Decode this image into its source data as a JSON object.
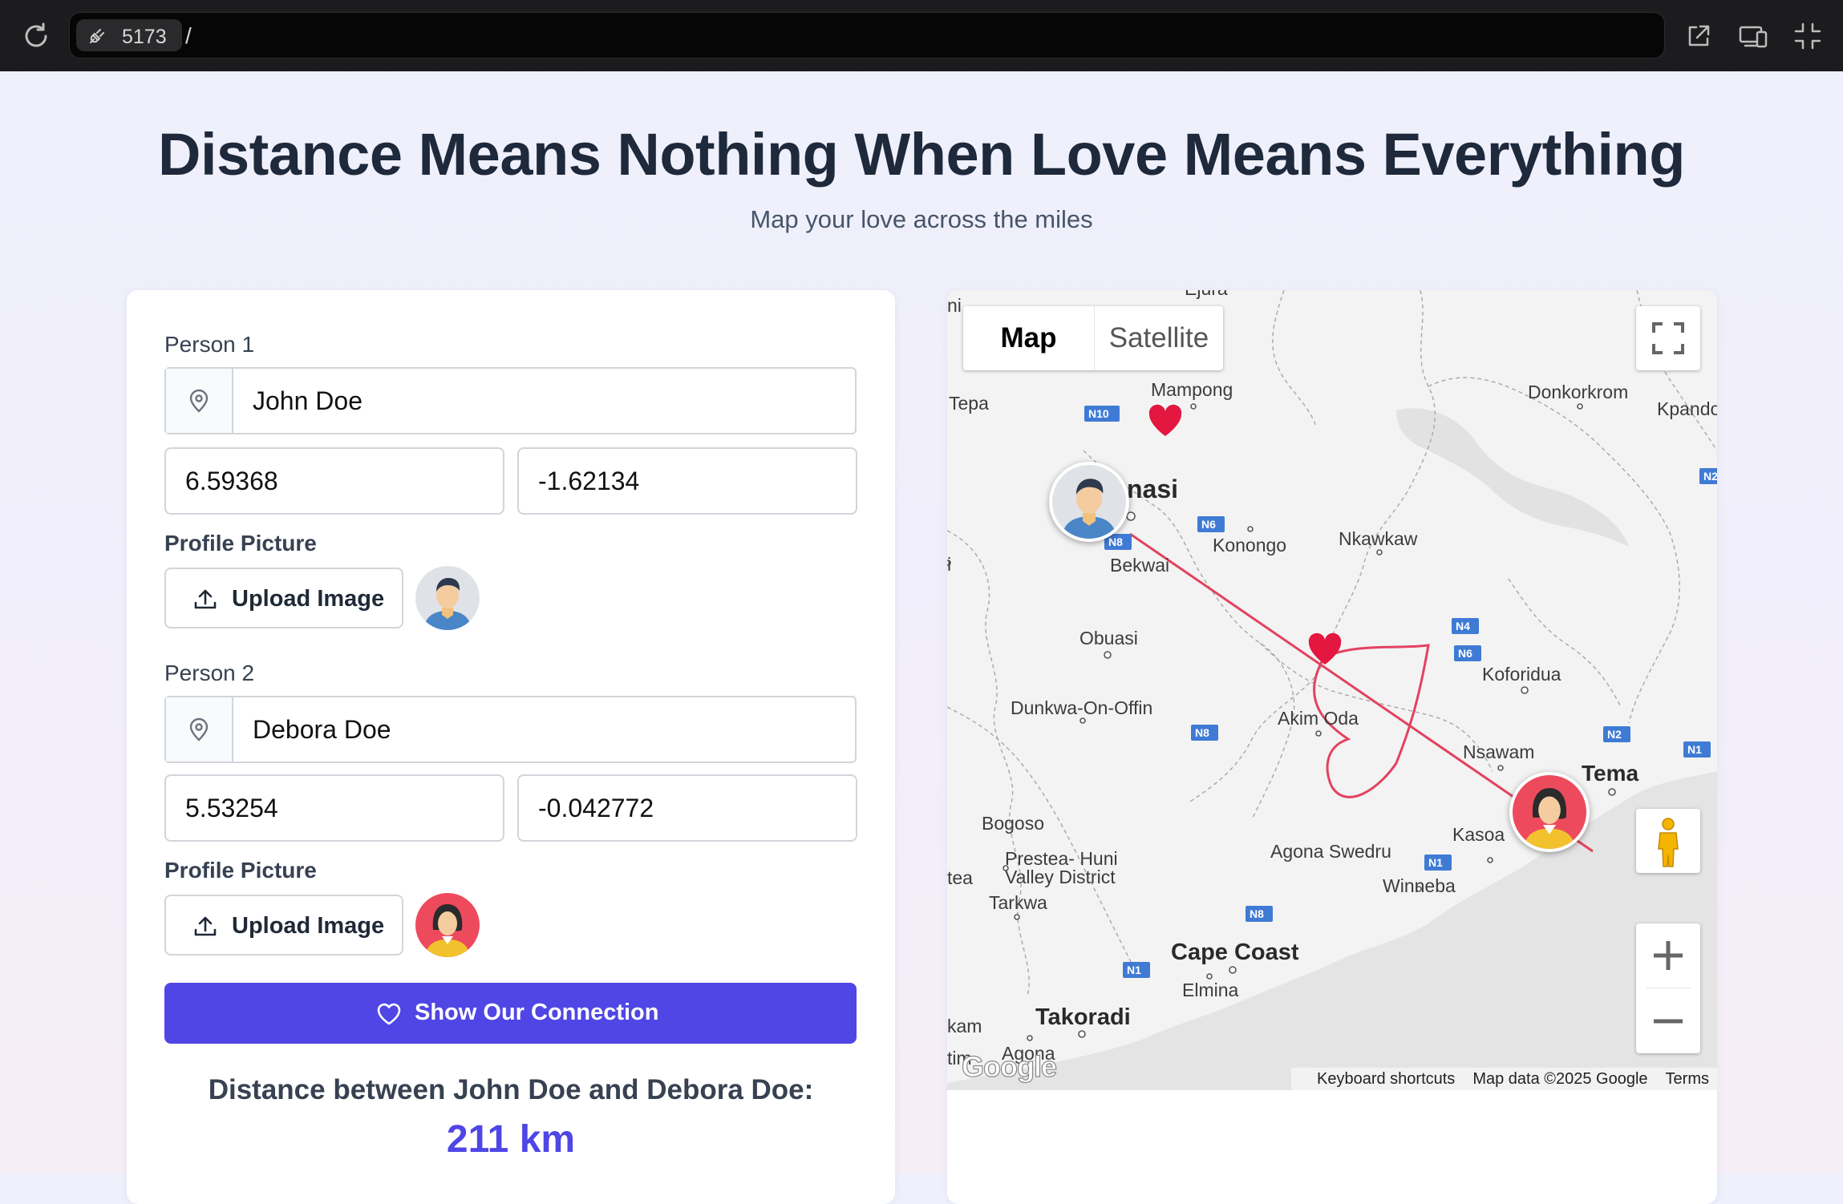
{
  "browser": {
    "port": "5173",
    "path": "/"
  },
  "header": {
    "title": "Distance Means Nothing When Love Means Everything",
    "subtitle": "Map your love across the miles"
  },
  "form": {
    "person1": {
      "label": "Person 1",
      "name": "John Doe",
      "lat": "6.59368",
      "lng": "-1.62134",
      "profile_label": "Profile Picture",
      "upload_label": "Upload Image",
      "avatar": "male-avatar"
    },
    "person2": {
      "label": "Person 2",
      "name": "Debora Doe",
      "lat": "5.53254",
      "lng": "-0.042772",
      "profile_label": "Profile Picture",
      "upload_label": "Upload Image",
      "avatar": "female-avatar"
    },
    "cta_label": "Show Our Connection",
    "distance_label": "Distance between John Doe and Debora Doe:",
    "distance_value": "211 km"
  },
  "map": {
    "type_map": "Map",
    "type_satellite": "Satellite",
    "selected_type": "Map",
    "places": {
      "ejura": "Ejura",
      "tepa": "Tepa",
      "mampong": "Mampong",
      "donkorkrom": "Donkorkrom",
      "kpando": "Kpando",
      "kumasi_partial": "nasi",
      "konongo": "Konongo",
      "nkawkaw": "Nkawkaw",
      "bekwai": "Bekwai",
      "obuasi": "Obuasi",
      "koforidua": "Koforidua",
      "dunkwa": "Dunkwa-On-Offin",
      "akim_oda": "Akim Oda",
      "nsawam": "Nsawam",
      "tema": "Tema",
      "bogoso": "Bogoso",
      "kasoa": "Kasoa",
      "prestea1": "Prestea- Huni",
      "prestea2": "Valley District",
      "agona_swedru": "Agona Swedru",
      "tarkwa": "Tarkwa",
      "winneba": "Winneba",
      "cape_coast": "Cape Coast",
      "elmina": "Elmina",
      "takoradi": "Takoradi",
      "agona": "Agona",
      "left_ni": "ni",
      "left_i": "i",
      "left_tea": "tea",
      "left_kam": "kam",
      "left_tim": "tim"
    },
    "roads": {
      "n10": "N10",
      "n6a": "N6",
      "n8a": "N8",
      "n4": "N4",
      "n6b": "N6",
      "n8b": "N8",
      "n2a": "N2",
      "n1a": "N1",
      "n1b": "N1",
      "n8c": "N8",
      "n1c": "N1",
      "n2b": "N2"
    },
    "attribution": {
      "shortcuts": "Keyboard shortcuts",
      "data": "Map data ©2025 Google",
      "terms": "Terms"
    },
    "logo": "Google",
    "colors": {
      "route": "#e3425f",
      "heart": "#e3173f",
      "road_badge": "#3f7bd5"
    }
  },
  "colors": {
    "accent": "#4f46e5",
    "title": "#1e293b"
  }
}
